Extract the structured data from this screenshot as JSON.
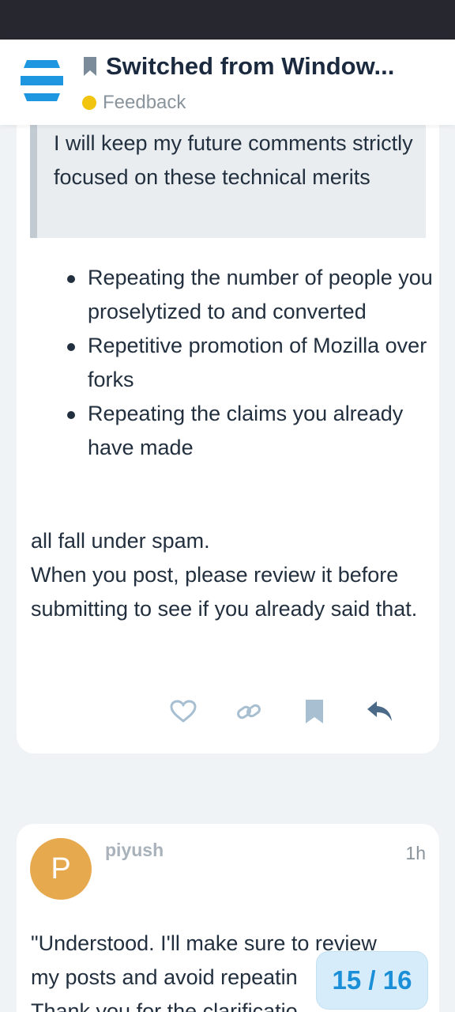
{
  "header": {
    "topic_title": "Switched from Window...",
    "category": "Feedback",
    "category_color": "#f1c40f",
    "brand_color": "#1e96e0"
  },
  "post1": {
    "quote_text": "I will keep my future comments strictly focused on these technical merits",
    "bullets": [
      "Repeating the number of people you proselytized to and converted",
      "Repetitive promotion of Mozilla over forks",
      "Repeating the claims you already have made"
    ],
    "paragraph_1": "all fall under spam.",
    "paragraph_2": "When you post, please review it before submitting to see if you already said that.",
    "actions": [
      "heart-icon",
      "link-icon",
      "bookmark-icon",
      "reply-icon"
    ]
  },
  "post2": {
    "avatar_letter": "P",
    "avatar_color": "#e7a94e",
    "username": "piyush",
    "time": "1h",
    "line_1": "\"Understood. I'll make sure to review",
    "line_2": "my posts and avoid repeatin",
    "line_3": "Thank you for the clarificatio"
  },
  "progress": {
    "label": "15 / 16"
  }
}
